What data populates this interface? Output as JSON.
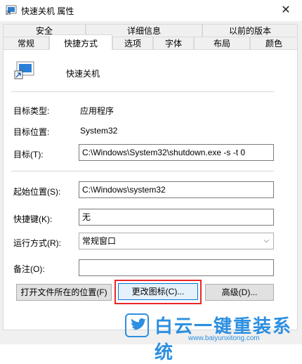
{
  "window": {
    "title": "快速关机 属性",
    "close_glyph": "✕"
  },
  "tabs": {
    "row1": [
      "安全",
      "详细信息",
      "以前的版本"
    ],
    "row2": [
      "常规",
      "快捷方式",
      "选项",
      "字体",
      "布局",
      "颜色"
    ],
    "active": "快捷方式"
  },
  "shortcut": {
    "name": "快速关机",
    "target_type_label": "目标类型:",
    "target_type_value": "应用程序",
    "target_location_label": "目标位置:",
    "target_location_value": "System32",
    "target_label": "目标(T):",
    "target_value": "C:\\Windows\\System32\\shutdown.exe -s -t 0",
    "start_in_label": "起始位置(S):",
    "start_in_value": "C:\\Windows\\system32",
    "hotkey_label": "快捷键(K):",
    "hotkey_value": "无",
    "run_label": "运行方式(R):",
    "run_value": "常规窗口",
    "comment_label": "备注(O):",
    "comment_value": ""
  },
  "buttons": {
    "open_location": "打开文件所在的位置(F)",
    "change_icon": "更改图标(C)...",
    "advanced": "高级(D)..."
  },
  "watermark": {
    "brand": "白云一键重装系统",
    "url": "www.baiyunxitong.com"
  },
  "colors": {
    "highlight": "#e8272b",
    "watermark": "#2d8fe0",
    "focus_border": "#0078d7"
  }
}
